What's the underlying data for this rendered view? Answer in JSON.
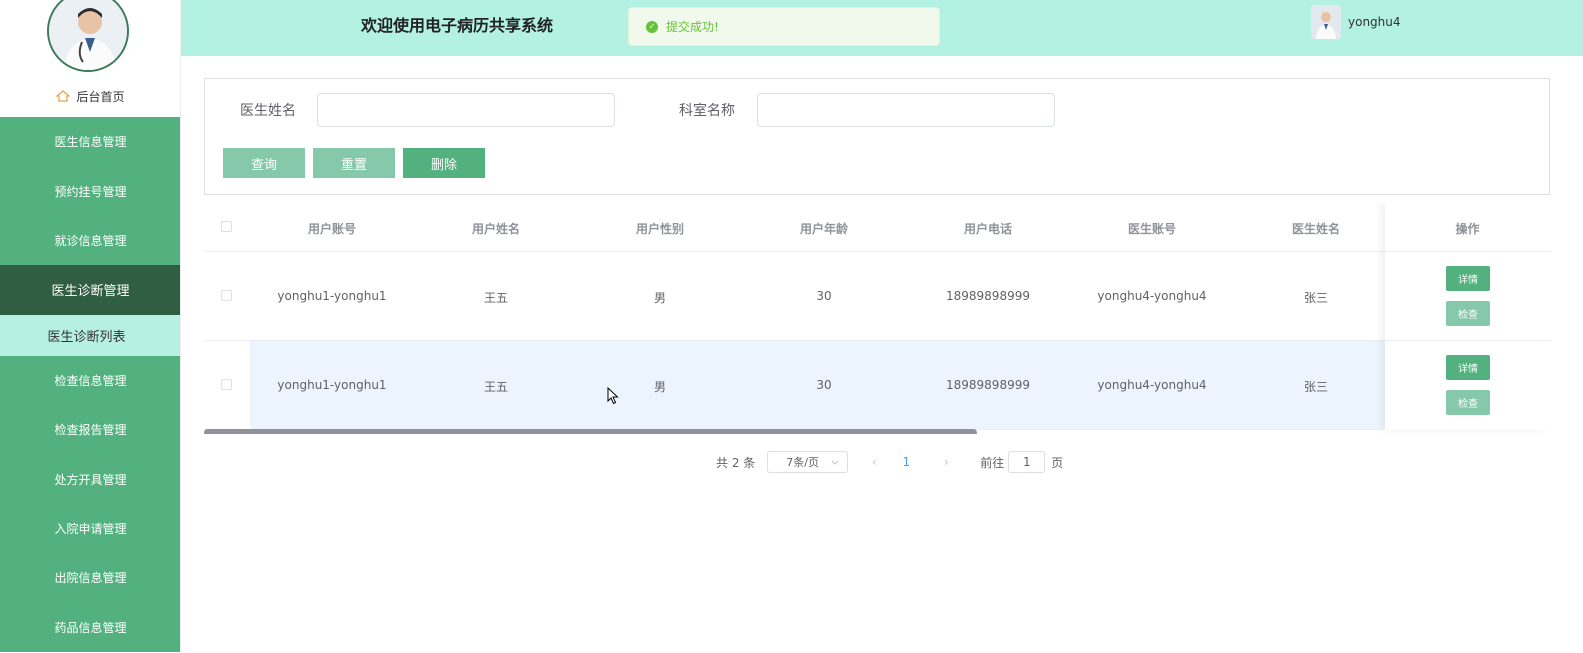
{
  "sidebar": {
    "home_label": "后台首页",
    "menu": [
      {
        "label": "医生信息管理"
      },
      {
        "label": "预约挂号管理"
      },
      {
        "label": "就诊信息管理"
      },
      {
        "label": "医生诊断管理",
        "active": true
      },
      {
        "label": "检查信息管理"
      },
      {
        "label": "检查报告管理"
      },
      {
        "label": "处方开具管理"
      },
      {
        "label": "入院申请管理"
      },
      {
        "label": "出院信息管理"
      },
      {
        "label": "药品信息管理"
      }
    ],
    "submenu_label": "医生诊断列表"
  },
  "header": {
    "title": "欢迎使用电子病历共享系统",
    "toast": "提交成功!",
    "username": "yonghu4"
  },
  "search": {
    "doctor_name_label": "医生姓名",
    "doctor_name_value": "",
    "dept_label": "科室名称",
    "dept_value": "",
    "query_label": "查询",
    "reset_label": "重置",
    "delete_label": "删除"
  },
  "table": {
    "columns": [
      "用户账号",
      "用户姓名",
      "用户性别",
      "用户年龄",
      "用户电话",
      "医生账号",
      "医生姓名"
    ],
    "op_column": "操作",
    "rows": [
      [
        "yonghu1-yonghu1",
        "王五",
        "男",
        "30",
        "18989898999",
        "yonghu4-yonghu4",
        "张三"
      ],
      [
        "yonghu1-yonghu1",
        "王五",
        "男",
        "30",
        "18989898999",
        "yonghu4-yonghu4",
        "张三"
      ]
    ],
    "detail_label": "详情",
    "check_label": "检查"
  },
  "pagination": {
    "total": "共 2 条",
    "page_size": "7条/页",
    "current_page": "1",
    "goto_label": "前往",
    "goto_value": "1",
    "page_suffix": "页"
  },
  "colors": {
    "menu_green": "#53b17f",
    "menu_active": "#2f5e42",
    "header_bg": "#b3f1e3",
    "success": "#67c23a"
  }
}
